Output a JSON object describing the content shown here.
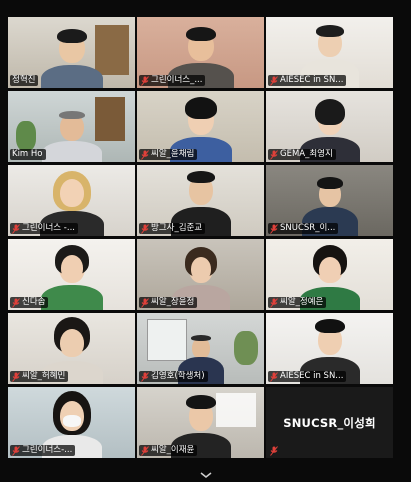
{
  "participants": [
    {
      "name": "정혁진",
      "muted": false
    },
    {
      "name": "그린이너스_...",
      "muted": true
    },
    {
      "name": "AIESEC in SN...",
      "muted": true
    },
    {
      "name": "Kim Ho",
      "muted": false,
      "active": true
    },
    {
      "name": "씨알_윤채림",
      "muted": true
    },
    {
      "name": "GEMA_최영지",
      "muted": true
    },
    {
      "name": "그린이너스 -...",
      "muted": true
    },
    {
      "name": "방그사_김준교",
      "muted": true
    },
    {
      "name": "SNUCSR_이...",
      "muted": true
    },
    {
      "name": "신다솜",
      "muted": true
    },
    {
      "name": "씨알_장윤정",
      "muted": true
    },
    {
      "name": "씨알_정예은",
      "muted": true
    },
    {
      "name": "씨알_허혜민",
      "muted": true
    },
    {
      "name": "김영호(학생처)",
      "muted": true
    },
    {
      "name": "AIESEC in SN...",
      "muted": true
    },
    {
      "name": "그린이너스-...",
      "muted": true
    },
    {
      "name": "씨알_이재윤",
      "muted": true
    },
    {
      "name": "SNUCSR_이성희",
      "muted": true,
      "video_off": true
    }
  ],
  "colors": {
    "active_border": "#e8e03a",
    "mic_off": "#e0403a",
    "background": "#000000"
  },
  "icons": {
    "mic_off": "mic-off-icon",
    "show_more": "chevron-down-icon"
  }
}
